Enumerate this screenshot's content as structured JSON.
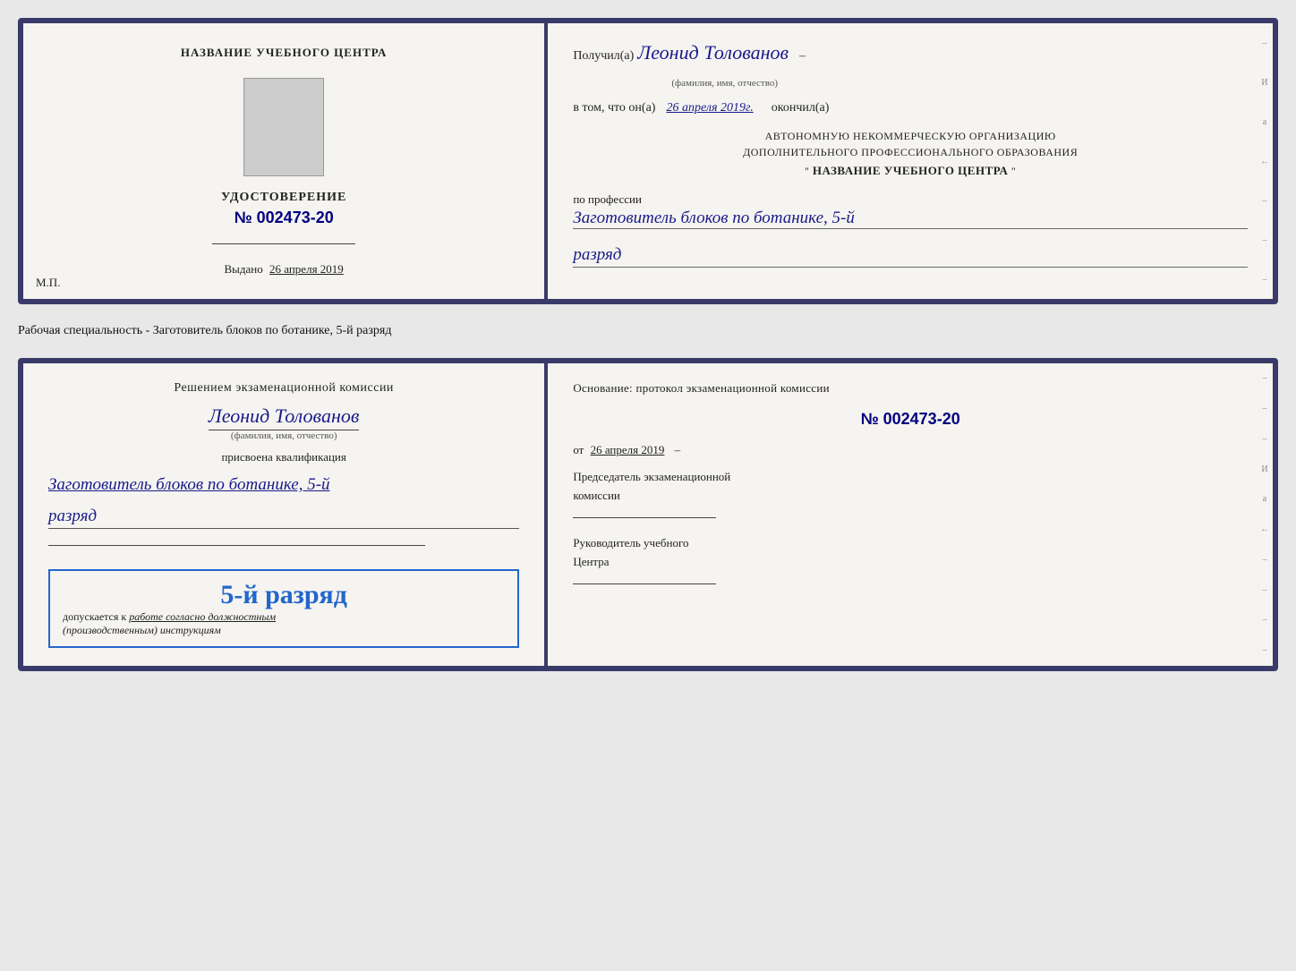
{
  "card1": {
    "left": {
      "training_center_label": "НАЗВАНИЕ УЧЕБНОГО ЦЕНТРА",
      "certificate_title": "УДОСТОВЕРЕНИЕ",
      "certificate_num": "№ 002473-20",
      "vydano_label": "Выдано",
      "vydano_date": "26 апреля 2019",
      "mp_label": "М.П."
    },
    "right": {
      "poluchil_label": "Получил(а)",
      "recipient_name": "Леонид Толованов",
      "fio_hint": "(фамилия, имя, отчество)",
      "vtom_label": "в том, что он(а)",
      "completion_date": "26 апреля 2019г.",
      "okonchil_label": "окончил(а)",
      "org_line1": "АВТОНОМНУЮ НЕКОММЕРЧЕСКУЮ ОРГАНИЗАЦИЮ",
      "org_line2": "ДОПОЛНИТЕЛЬНОГО ПРОФЕССИОНАЛЬНОГО ОБРАЗОВАНИЯ",
      "org_name": "НАЗВАНИЕ УЧЕБНОГО ЦЕНТРА",
      "org_quotes": "\"",
      "po_professii_label": "по профессии",
      "profession": "Заготовитель блоков по ботанике, 5-й",
      "razryad": "разряд"
    }
  },
  "specialty_label": "Рабочая специальность - Заготовитель блоков по ботанике, 5-й разряд",
  "card2": {
    "left": {
      "resheniem_label": "Решением экзаменационной комиссии",
      "name": "Леонид Толованов",
      "fio_hint": "(фамилия, имя, отчество)",
      "prisvoena_label": "присвоена квалификация",
      "qualification": "Заготовитель блоков по ботанике, 5-й",
      "razryad": "разряд",
      "stamp_rank": "5-й разряд",
      "dopusk_label": "допускается к",
      "dopusk_text": "работе согласно должностным",
      "dopusk_text2": "(производственным) инструкциям"
    },
    "right": {
      "osnovanie_label": "Основание: протокол экзаменационной комиссии",
      "protocol_num": "№  002473-20",
      "ot_label": "от",
      "ot_date": "26 апреля 2019",
      "predsedatel_label": "Председатель экзаменационной",
      "predsedatel_label2": "комиссии",
      "rukovoditel_label": "Руководитель учебного",
      "rukovoditel_label2": "Центра"
    }
  }
}
